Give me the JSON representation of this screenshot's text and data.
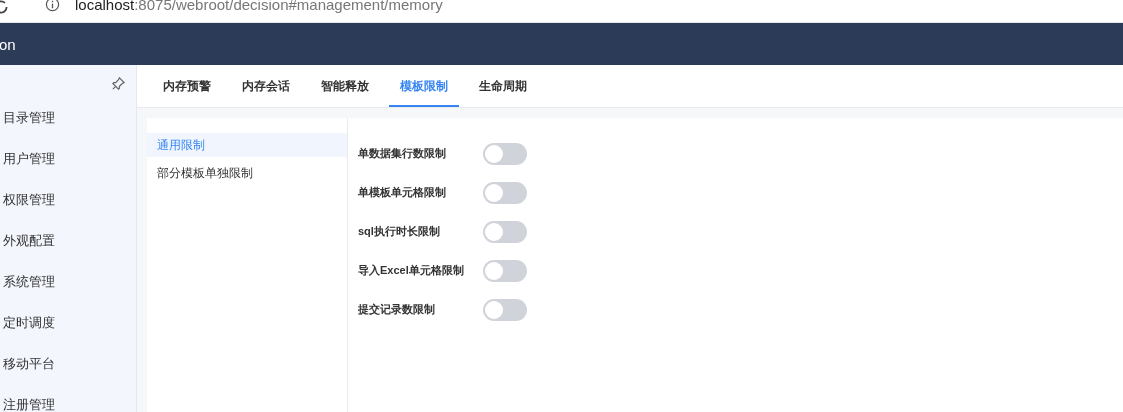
{
  "address_bar": {
    "host": "localhost",
    "path": ":8075/webroot/decision#management/memory"
  },
  "header": {
    "title": "on"
  },
  "sidebar": {
    "items": [
      {
        "label": "目录管理",
        "selected": false
      },
      {
        "label": "用户管理",
        "selected": false
      },
      {
        "label": "权限管理",
        "selected": false
      },
      {
        "label": "外观配置",
        "selected": false
      },
      {
        "label": "系统管理",
        "selected": false
      },
      {
        "label": "定时调度",
        "selected": false
      },
      {
        "label": "移动平台",
        "selected": false
      },
      {
        "label": "注册管理",
        "selected": false
      }
    ]
  },
  "tabs": [
    {
      "label": "内存预警",
      "selected": false
    },
    {
      "label": "内存会话",
      "selected": false
    },
    {
      "label": "智能释放",
      "selected": false
    },
    {
      "label": "模板限制",
      "selected": true
    },
    {
      "label": "生命周期",
      "selected": false
    }
  ],
  "sub_menu": [
    {
      "label": "通用限制",
      "selected": true
    },
    {
      "label": "部分模板单独限制",
      "selected": false
    }
  ],
  "settings": [
    {
      "label": "单数据集行数限制",
      "on": false
    },
    {
      "label": "单模板单元格限制",
      "on": false
    },
    {
      "label": "sql执行时长限制",
      "on": false
    },
    {
      "label": "导入Excel单元格限制",
      "on": false
    },
    {
      "label": "提交记录数限制",
      "on": false
    }
  ]
}
